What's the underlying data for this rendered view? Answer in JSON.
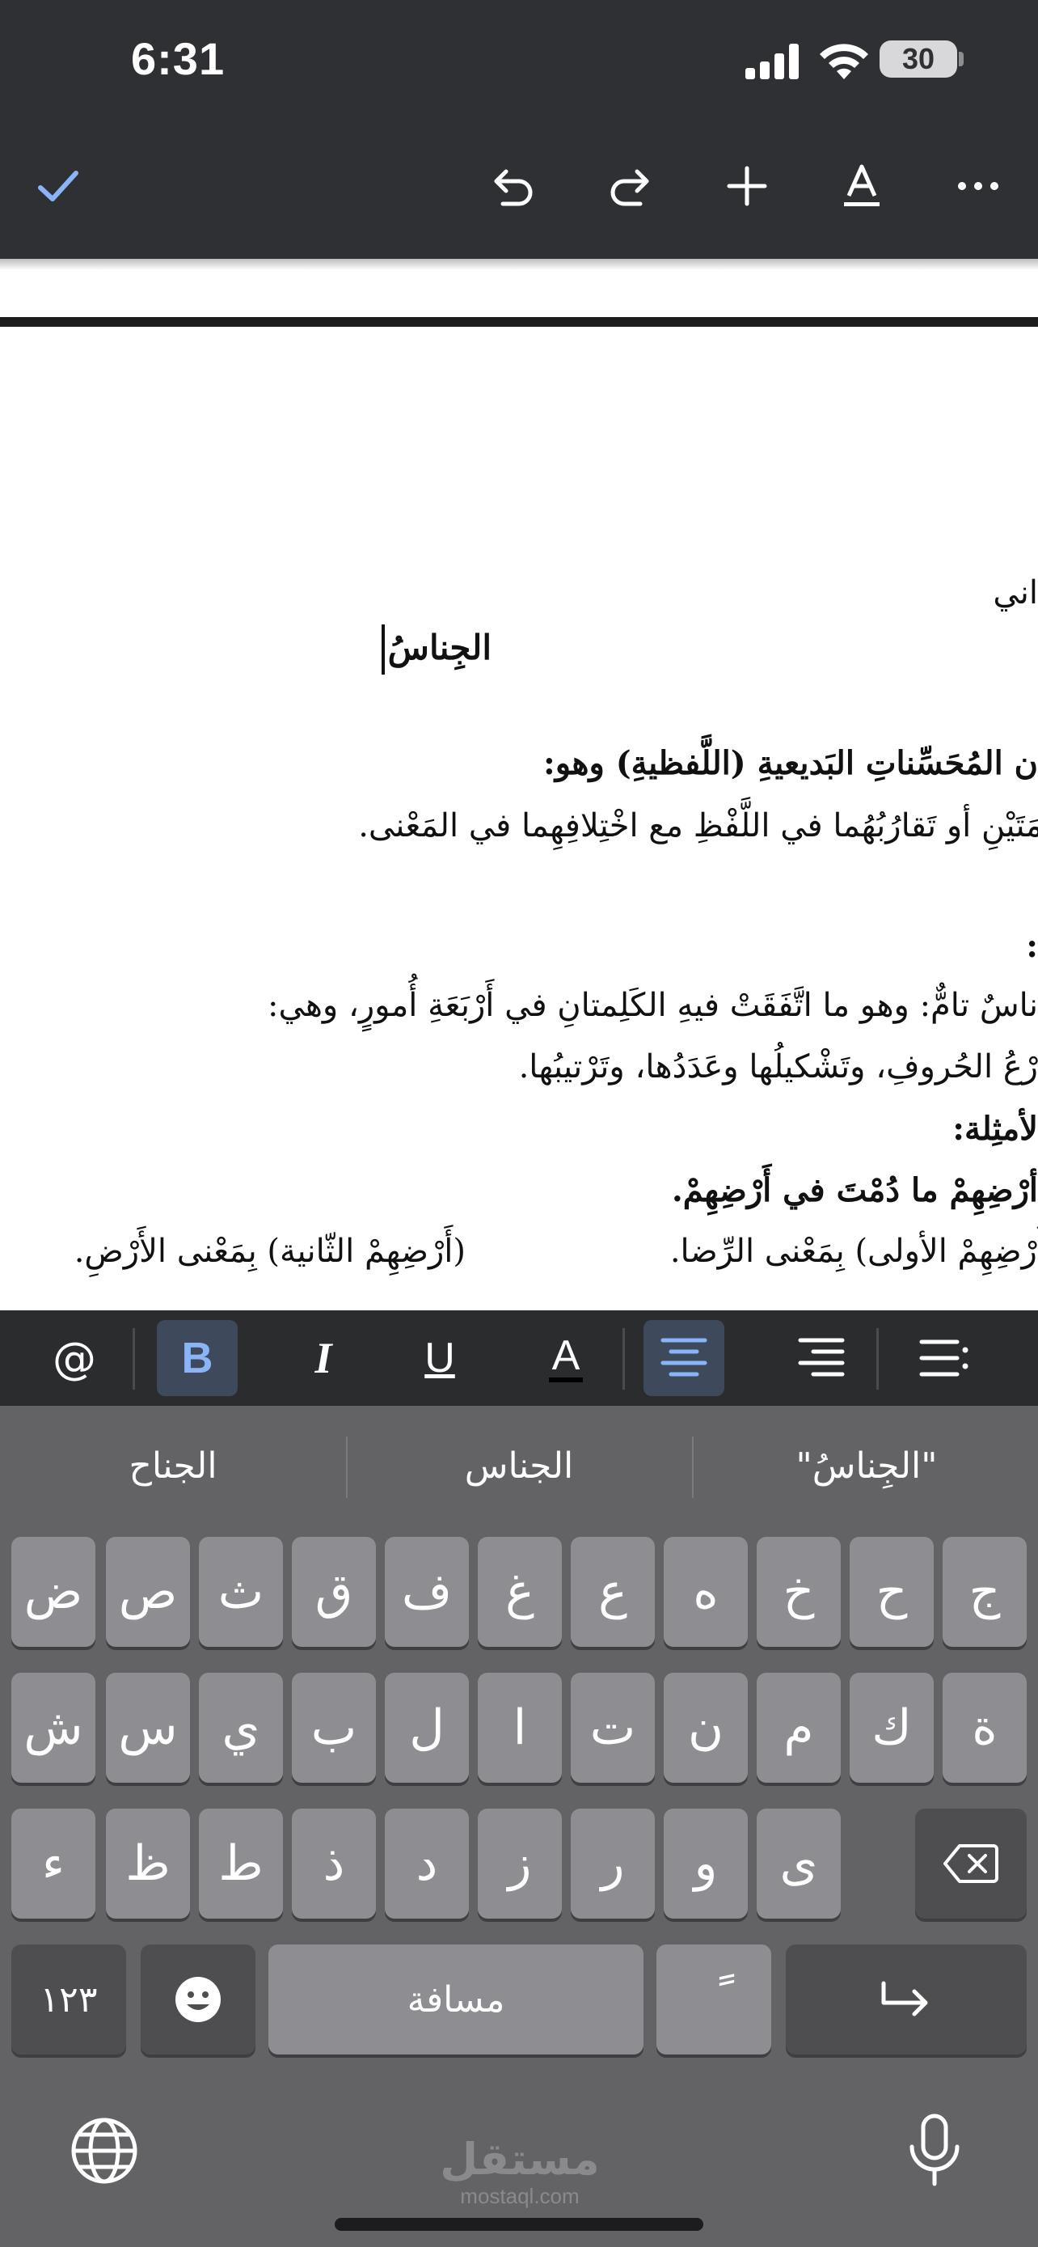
{
  "status_bar": {
    "time": "6:31",
    "battery": "30"
  },
  "toolbar": {
    "confirm_icon": "checkmark-icon",
    "undo_icon": "undo-icon",
    "redo_icon": "redo-icon",
    "insert_icon": "plus-icon",
    "text_format_icon": "text-format-icon",
    "more_icon": "more-icon"
  },
  "document": {
    "lines": [
      "اني",
      "الجِناسُ",
      "ن المُحَسِّناتِ البَديعيةِ (اللَّفظيةِ) وهو:",
      "مَتَيْنِ أو تَقارُبُهُما في اللَّفْظِ مع اخْتِلافِهِما في المَعْنى.",
      ":",
      "ناسٌ تامٌّ: وهو ما اتَّفَقَتْ فيهِ الكَلِمتانِ في أَرْبَعَةِ أُمورٍ، وهي:",
      "رْعُ الحُروفِ، وتَشْكيلُها وعَدَدُها، وتَرْتيبُها.",
      "لأمثِلة:",
      "أرْضِهِمْ ما دُمْتَ في أَرْضِهِمْ.",
      "أَرْضِهِمْ الأولى) بِمَعْنى الرِّضا.",
      "(أَرْضِهِمْ الثّانية) بِمَعْنى الأَرْضِ."
    ]
  },
  "format_bar": {
    "mention": "@",
    "bold": "B",
    "italic": "I",
    "underline": "U",
    "text_color": "A"
  },
  "keyboard": {
    "suggestions": [
      "\"الجِناسُ\"",
      "الجناس",
      "الجناح"
    ],
    "rows": [
      [
        "ج",
        "ح",
        "خ",
        "ه",
        "ع",
        "غ",
        "ف",
        "ق",
        "ث",
        "ص",
        "ض"
      ],
      [
        "ة",
        "ك",
        "م",
        "ن",
        "ت",
        "ا",
        "ل",
        "ب",
        "ي",
        "س",
        "ش"
      ],
      [
        "ى",
        "و",
        "ر",
        "ز",
        "د",
        "ذ",
        "ط",
        "ظ",
        "ء"
      ]
    ],
    "numbers_key": "١٢٣",
    "space": "مسافة",
    "tanween": "ً",
    "emoji_icon": "emoji-icon",
    "return_icon": "return-icon",
    "delete_icon": "delete-icon",
    "globe_icon": "globe-icon",
    "mic_icon": "microphone-icon"
  },
  "watermark": {
    "arabic": "مستقل",
    "latin": "mostaql.com"
  },
  "colors": {
    "accent": "#8ab4f8",
    "toolbar_bg": "#2e3033",
    "key_bg": "#8e8e92"
  }
}
